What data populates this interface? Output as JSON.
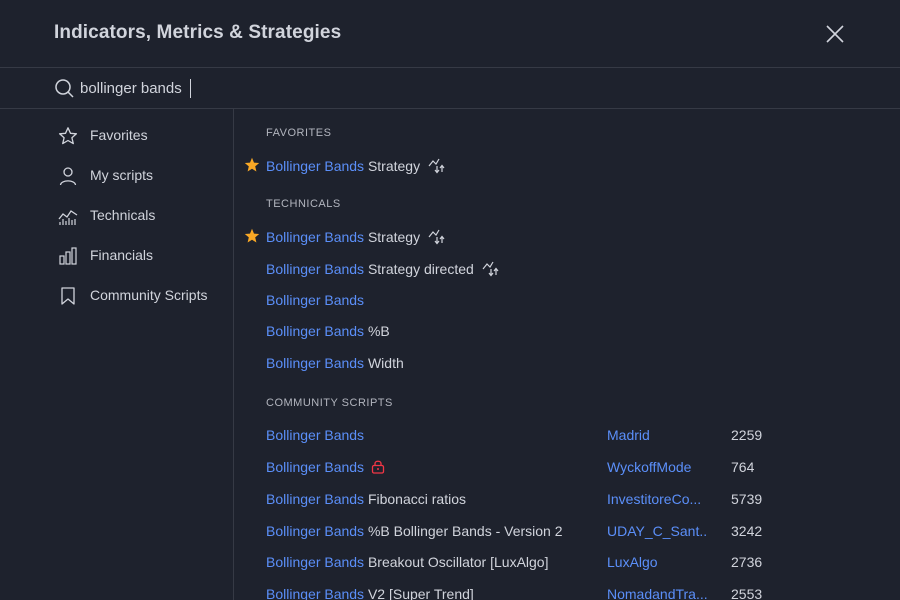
{
  "header": {
    "title": "Indicators, Metrics & Strategies"
  },
  "search": {
    "value": "bollinger bands"
  },
  "sidebar": {
    "items": [
      {
        "label": "Favorites",
        "icon": "star-icon"
      },
      {
        "label": "My scripts",
        "icon": "user-icon"
      },
      {
        "label": "Technicals",
        "icon": "technicals-chart-icon"
      },
      {
        "label": "Financials",
        "icon": "bar-chart-icon"
      },
      {
        "label": "Community Scripts",
        "icon": "bookmark-icon"
      }
    ]
  },
  "sections": {
    "favorites": "FAVORITES",
    "technicals": "TECHNICALS",
    "community": "COMMUNITY SCRIPTS"
  },
  "favorites": [
    {
      "highlight": "Bollinger Bands",
      "rest": " Strategy",
      "starred": true,
      "strategy_icon": true
    }
  ],
  "technicals": [
    {
      "highlight": "Bollinger Bands",
      "rest": " Strategy",
      "starred": true,
      "strategy_icon": true
    },
    {
      "highlight": "Bollinger Bands",
      "rest": " Strategy directed",
      "starred": false,
      "strategy_icon": true
    },
    {
      "highlight": "Bollinger Bands",
      "rest": "",
      "starred": false,
      "strategy_icon": false
    },
    {
      "highlight": "Bollinger Bands",
      "rest": " %B",
      "starred": false,
      "strategy_icon": false
    },
    {
      "highlight": "Bollinger Bands",
      "rest": " Width",
      "starred": false,
      "strategy_icon": false
    }
  ],
  "community": [
    {
      "highlight": "Bollinger Bands",
      "rest": "",
      "author": "Madrid",
      "count": "2259"
    },
    {
      "highlight": "Bollinger Bands",
      "rest": "",
      "locked": true,
      "author": "WyckoffMode",
      "count": "764"
    },
    {
      "highlight": "Bollinger Bands",
      "rest": " Fibonacci ratios",
      "author": "InvestitoreCo...",
      "count": "5739"
    },
    {
      "highlight": "Bollinger Bands",
      "rest": " %B Bollinger Bands - Version 2",
      "author": "UDAY_C_Sant...",
      "count": "3242"
    },
    {
      "highlight": "Bollinger Bands",
      "rest": " Breakout Oscillator [LuxAlgo]",
      "author": "LuxAlgo",
      "count": "2736"
    },
    {
      "highlight": "Bollinger Bands",
      "rest": " V2 [Super Trend]",
      "author": "NomadandTra...",
      "count": "2553"
    }
  ],
  "colors": {
    "background": "#1e222d",
    "highlight": "#5b8ff9",
    "star": "#f9a825",
    "lock": "#f23645",
    "divider": "#363a45"
  }
}
